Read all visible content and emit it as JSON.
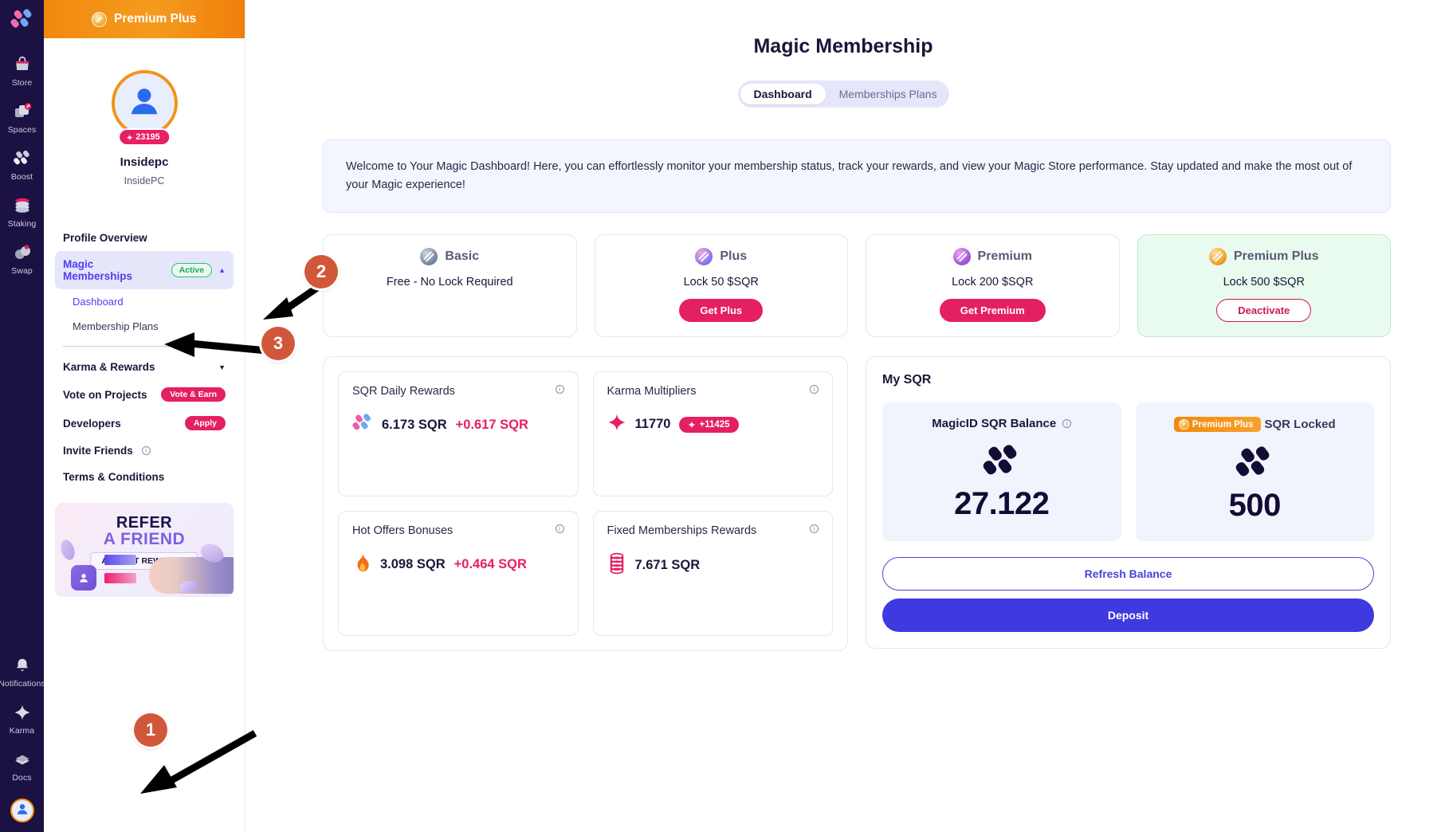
{
  "rail": {
    "logo_icon": "magic-logo-icon",
    "items": [
      {
        "label": "Store",
        "icon": "store-bag-icon"
      },
      {
        "label": "Spaces",
        "icon": "spaces-stack-icon"
      },
      {
        "label": "Boost",
        "icon": "boost-icon"
      },
      {
        "label": "Staking",
        "icon": "staking-coins-icon"
      },
      {
        "label": "Swap",
        "icon": "swap-icon"
      }
    ],
    "bottom_items": [
      {
        "label": "Notifications",
        "icon": "bell-icon"
      },
      {
        "label": "Karma",
        "icon": "sparkle-icon"
      },
      {
        "label": "Docs",
        "icon": "docs-icon"
      }
    ],
    "avatar_icon": "user-avatar-icon"
  },
  "sidebar": {
    "plan_banner": {
      "label": "Premium Plus",
      "icon": "coin-icon"
    },
    "profile": {
      "avatar_icon": "user-avatar-icon",
      "karma_points": "23195",
      "karma_icon": "sparkle-icon",
      "name": "Insidepc",
      "handle": "InsidePC"
    },
    "nav": [
      {
        "label": "Profile Overview",
        "type": "item"
      },
      {
        "label": "Magic Memberships",
        "type": "item",
        "active": true,
        "badge": "Active",
        "caret": "caret-up-icon"
      },
      {
        "label": "Dashboard",
        "type": "sub",
        "current": true
      },
      {
        "label": "Membership Plans",
        "type": "sub"
      },
      {
        "label": "Karma & Rewards",
        "type": "item",
        "caret": "caret-down-icon"
      },
      {
        "label": "Vote on Projects",
        "type": "item",
        "pill": "Vote & Earn"
      },
      {
        "label": "Developers",
        "type": "item",
        "pill": "Apply"
      },
      {
        "label": "Invite Friends",
        "type": "item",
        "info": true
      },
      {
        "label": "Terms & Conditions",
        "type": "item"
      }
    ],
    "refer_banner": {
      "line1": "REFER",
      "line2": "A FRIEND",
      "chip": "AND GET REWARDS!"
    }
  },
  "main": {
    "page_title": "Magic Membership",
    "tabs": [
      {
        "label": "Dashboard",
        "active": true
      },
      {
        "label": "Memberships Plans",
        "active": false
      }
    ],
    "welcome": "Welcome to Your Magic Dashboard! Here, you can effortlessly monitor your membership status, track your rewards, and view your Magic Store performance. Stay updated and make the most out of your Magic experience!",
    "tiers": [
      {
        "name": "Basic",
        "lock": "Free - No Lock Required",
        "button": null,
        "owned": false,
        "token": "basic"
      },
      {
        "name": "Plus",
        "lock": "Lock 50 $SQR",
        "button": "Get Plus",
        "owned": false,
        "token": "plus"
      },
      {
        "name": "Premium",
        "lock": "Lock 200 $SQR",
        "button": "Get Premium",
        "owned": false,
        "token": "prem"
      },
      {
        "name": "Premium Plus",
        "lock": "Lock 500 $SQR",
        "button": "Deactivate",
        "owned": true,
        "token": "premplus"
      }
    ],
    "reward_cards": [
      {
        "title": "SQR Daily Rewards",
        "icon": "magic-logo-icon",
        "value": "6.173 SQR",
        "delta": "+0.617 SQR",
        "badge": null
      },
      {
        "title": "Karma Multipliers",
        "icon": "sparkle-icon",
        "value": "11770",
        "delta": null,
        "badge": "+11425"
      },
      {
        "title": "Hot Offers Bonuses",
        "icon": "flame-icon",
        "value": "3.098 SQR",
        "delta": "+0.464 SQR",
        "badge": null
      },
      {
        "title": "Fixed Memberships Rewards",
        "icon": "coin-stack-icon",
        "value": "7.671 SQR",
        "delta": null,
        "badge": null
      }
    ],
    "sqr": {
      "title": "My SQR",
      "balance_card": {
        "label": "MagicID SQR Balance",
        "value": "27.122",
        "icon": "magic-mark-icon"
      },
      "locked_card": {
        "chip": "Premium Plus",
        "label": "SQR Locked",
        "value": "500",
        "icon": "magic-mark-icon"
      },
      "refresh_button": "Refresh Balance",
      "deposit_button": "Deposit"
    }
  },
  "annotations": [
    {
      "number": "1"
    },
    {
      "number": "2"
    },
    {
      "number": "3"
    }
  ]
}
